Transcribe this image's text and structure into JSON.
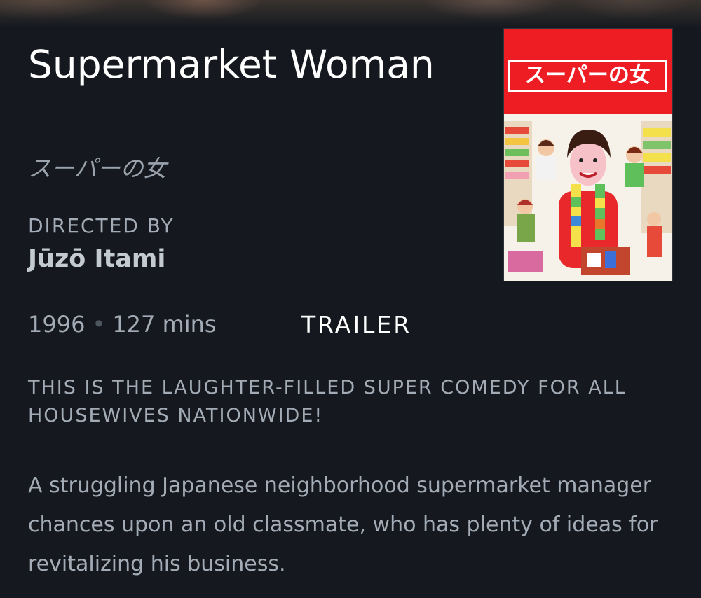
{
  "movie": {
    "title": "Supermarket Woman",
    "original_title": "スーパーの女",
    "directed_by_label": "DIRECTED BY",
    "director": "Jūzō Itami",
    "year": "1996",
    "separator": "•",
    "runtime": "127 mins",
    "trailer_label": "TRAILER",
    "tagline": "THIS IS THE LAUGHTER-FILLED SUPER COMEDY FOR ALL HOUSEWIVES NATIONWIDE!",
    "overview": "A struggling Japanese neighborhood supermarket manager chances upon an old classmate, who has plenty of ideas for revitalizing his business."
  },
  "poster": {
    "title_text": "スーパーの女",
    "band_color": "#ee1d24"
  },
  "colors": {
    "background": "#15191f",
    "title": "#ffffff",
    "muted_text": "#a3acb6"
  }
}
